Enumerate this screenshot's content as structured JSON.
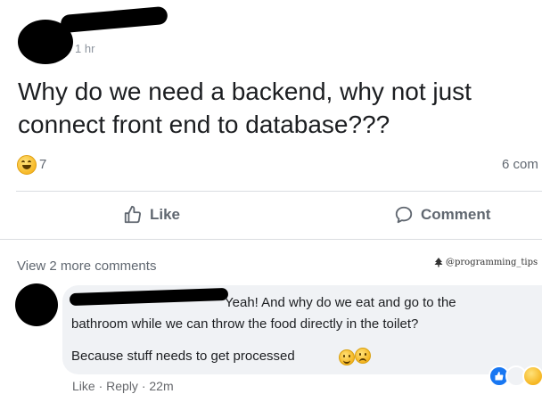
{
  "post": {
    "time": "1 hr",
    "text_line1": "Why do we need a backend, why not just",
    "text_line2": "connect front end to database???",
    "reaction_count": "7",
    "comment_count": "6 com"
  },
  "actions": {
    "like_label": "Like",
    "comment_label": "Comment"
  },
  "comments_section": {
    "view_more": "View 2 more comments",
    "watermark": "@programming_tips",
    "comment": {
      "line1": "Yeah! And why do we eat and go to the",
      "line2": "bathroom while we can throw the food directly in the toilet?",
      "line3": "Because stuff needs to get processed",
      "actions": {
        "like": "Like",
        "sep1": " · ",
        "reply": "Reply",
        "sep2": " · ",
        "time": "22m"
      }
    }
  },
  "icons": {
    "reaction": "haha-emoji-icon",
    "like": "thumbs-up-icon",
    "comment": "speech-bubble-icon",
    "watermark": "tree-logo-icon"
  },
  "colors": {
    "text": "#1c1e21",
    "secondary": "#606770",
    "bubble": "#f0f2f5",
    "like_blue": "#1877f2"
  }
}
